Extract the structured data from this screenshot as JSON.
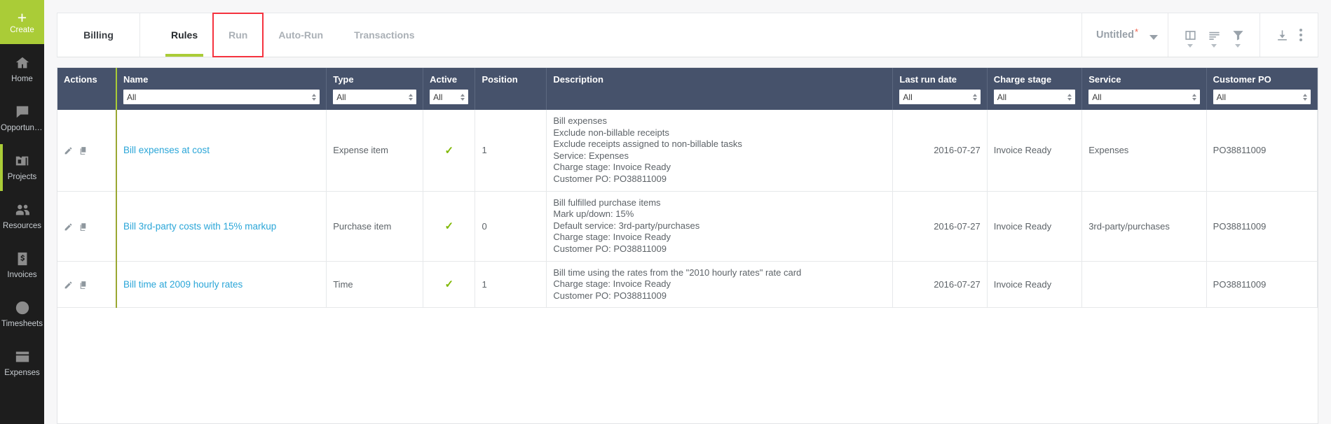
{
  "sidebar": {
    "create": {
      "label": "Create",
      "icon": "plus-icon"
    },
    "items": [
      {
        "label": "Home",
        "icon": "home-icon",
        "active": false
      },
      {
        "label": "Opportunit…",
        "icon": "speech-bubble-icon",
        "active": false
      },
      {
        "label": "Projects",
        "icon": "projects-icon",
        "active": true
      },
      {
        "label": "Resources",
        "icon": "people-icon",
        "active": false
      },
      {
        "label": "Invoices",
        "icon": "dollar-card-icon",
        "active": false
      },
      {
        "label": "Timesheets",
        "icon": "clock-icon",
        "active": false
      },
      {
        "label": "Expenses",
        "icon": "credit-card-icon",
        "active": false
      }
    ]
  },
  "header": {
    "module_label": "Billing",
    "tabs": [
      {
        "label": "Rules",
        "active": true,
        "highlighted": false
      },
      {
        "label": "Run",
        "active": false,
        "highlighted": true
      },
      {
        "label": "Auto-Run",
        "active": false,
        "highlighted": false
      },
      {
        "label": "Transactions",
        "active": false,
        "highlighted": false
      }
    ],
    "view_name": "Untitled",
    "view_modified_marker": "*",
    "toolbar_icons": [
      "columns-icon",
      "group-sort-icon",
      "filter-icon",
      "download-icon",
      "more-options-icon"
    ]
  },
  "table": {
    "columns": [
      {
        "key": "actions",
        "label": "Actions",
        "filter": null
      },
      {
        "key": "name",
        "label": "Name",
        "filter": "All"
      },
      {
        "key": "type",
        "label": "Type",
        "filter": "All"
      },
      {
        "key": "active",
        "label": "Active",
        "filter": "All"
      },
      {
        "key": "position",
        "label": "Position",
        "filter": null
      },
      {
        "key": "description",
        "label": "Description",
        "filter": null
      },
      {
        "key": "last_run_date",
        "label": "Last run date",
        "filter": "All"
      },
      {
        "key": "charge_stage",
        "label": "Charge stage",
        "filter": "All"
      },
      {
        "key": "service",
        "label": "Service",
        "filter": "All"
      },
      {
        "key": "customer_po",
        "label": "Customer PO",
        "filter": "All"
      }
    ],
    "row_actions": [
      "edit-pencil-icon",
      "copy-icon"
    ],
    "active_check_glyph": "✓",
    "rows": [
      {
        "name": "Bill expenses at cost",
        "type": "Expense item",
        "active": true,
        "position": "1",
        "description": [
          "Bill expenses",
          "Exclude non-billable receipts",
          "Exclude receipts assigned to non-billable tasks",
          "Service: Expenses",
          "Charge stage: Invoice Ready",
          "Customer PO: PO38811009"
        ],
        "last_run_date": "2016-07-27",
        "charge_stage": "Invoice Ready",
        "service": "Expenses",
        "customer_po": "PO38811009"
      },
      {
        "name": "Bill 3rd-party costs with 15% markup",
        "type": "Purchase item",
        "active": true,
        "position": "0",
        "description": [
          "Bill fulfilled purchase items",
          "Mark up/down: 15%",
          "Default service: 3rd-party/purchases",
          "Charge stage: Invoice Ready",
          "Customer PO: PO38811009"
        ],
        "last_run_date": "2016-07-27",
        "charge_stage": "Invoice Ready",
        "service": "3rd-party/purchases",
        "customer_po": "PO38811009"
      },
      {
        "name": "Bill time at 2009 hourly rates",
        "type": "Time",
        "active": true,
        "position": "1",
        "description": [
          "Bill time using the rates from the \"2010 hourly rates\" rate card",
          "Charge stage: Invoice Ready",
          "Customer PO: PO38811009"
        ],
        "last_run_date": "2016-07-27",
        "charge_stage": "Invoice Ready",
        "service": "",
        "customer_po": "PO38811009"
      }
    ]
  },
  "colors": {
    "accent_green": "#aacc37",
    "header_blue": "#46526b",
    "link_blue": "#2ba6d8",
    "highlight_red": "#f5333f",
    "sidebar_dark": "#1d1d1d"
  }
}
